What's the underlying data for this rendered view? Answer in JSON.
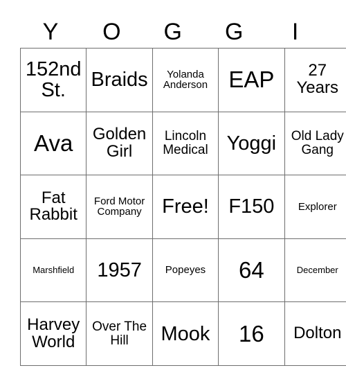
{
  "card": {
    "header_letters": [
      "Y",
      "O",
      "G",
      "G",
      "I"
    ],
    "rows": [
      [
        {
          "text": "152nd St.",
          "size": "lg"
        },
        {
          "text": "Braids",
          "size": "lg"
        },
        {
          "text": "Yolanda Anderson",
          "size": "xs"
        },
        {
          "text": "EAP",
          "size": "xl"
        },
        {
          "text": "27 Years",
          "size": "md"
        }
      ],
      [
        {
          "text": "Ava",
          "size": "xl"
        },
        {
          "text": "Golden Girl",
          "size": "md"
        },
        {
          "text": "Lincoln Medical",
          "size": "sm"
        },
        {
          "text": "Yoggi",
          "size": "lg"
        },
        {
          "text": "Old Lady Gang",
          "size": "sm"
        }
      ],
      [
        {
          "text": "Fat Rabbit",
          "size": "md"
        },
        {
          "text": "Ford Motor Company",
          "size": "xs"
        },
        {
          "text": "Free!",
          "size": "lg"
        },
        {
          "text": "F150",
          "size": "lg"
        },
        {
          "text": "Explorer",
          "size": "xs"
        }
      ],
      [
        {
          "text": "Marshfield",
          "size": "xxs"
        },
        {
          "text": "1957",
          "size": "lg"
        },
        {
          "text": "Popeyes",
          "size": "xs"
        },
        {
          "text": "64",
          "size": "xl"
        },
        {
          "text": "December",
          "size": "xxs"
        }
      ],
      [
        {
          "text": "Harvey World",
          "size": "md"
        },
        {
          "text": "Over The Hill",
          "size": "sm"
        },
        {
          "text": "Mook",
          "size": "lg"
        },
        {
          "text": "16",
          "size": "xl"
        },
        {
          "text": "Dolton",
          "size": "md"
        }
      ]
    ],
    "free_space": {
      "row": 2,
      "col": 2,
      "label": "Free!"
    },
    "colors": {
      "background": "#ffffff",
      "text": "#000000",
      "grid_line": "#6e6e6e"
    }
  }
}
